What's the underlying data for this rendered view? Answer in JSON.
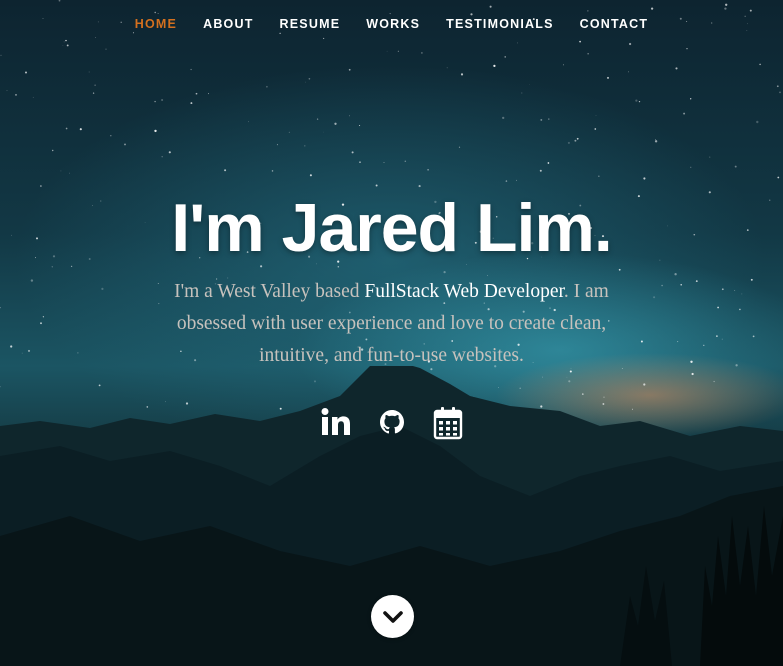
{
  "nav": {
    "items": [
      {
        "label": "HOME",
        "active": true
      },
      {
        "label": "ABOUT"
      },
      {
        "label": "RESUME"
      },
      {
        "label": "WORKS"
      },
      {
        "label": "TESTIMONIALS"
      },
      {
        "label": "CONTACT"
      }
    ]
  },
  "hero": {
    "title": "I'm Jared Lim.",
    "intro_before": "I'm a West Valley based ",
    "intro_highlight": "FullStack Web Developer",
    "intro_after": ". I am obsessed with user experience and love to create clean, intuitive, and fun-to-use websites."
  },
  "social": [
    {
      "icon": "linkedin-icon"
    },
    {
      "icon": "github-icon"
    },
    {
      "icon": "calendar-icon"
    }
  ],
  "scroll": {
    "icon": "chevron-down-icon"
  },
  "colors": {
    "accent": "#d4701f",
    "text": "#ffffff",
    "intro_text": "#c7c2bd"
  }
}
